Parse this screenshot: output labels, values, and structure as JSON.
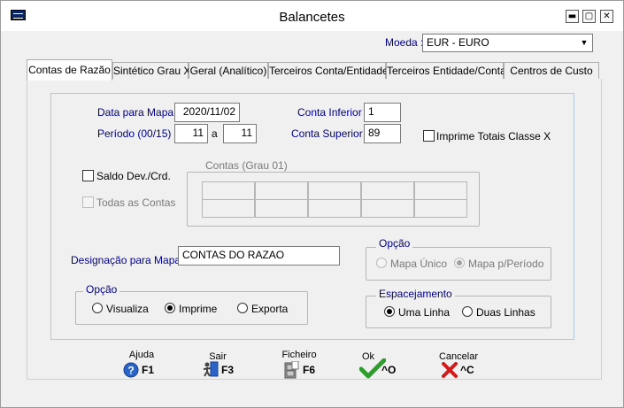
{
  "window": {
    "title": "Balancetes",
    "buttons": {
      "minimize": "▬",
      "maximize": "▢",
      "close": "✕"
    }
  },
  "currency": {
    "label": "Moeda :",
    "value": "EUR - EURO"
  },
  "tabs": [
    {
      "label": "Contas de Razão",
      "active": true
    },
    {
      "label": "Sintético Grau X",
      "active": false
    },
    {
      "label": "Geral (Analítico)",
      "active": false
    },
    {
      "label": "Terceiros Conta/Entidade",
      "active": false
    },
    {
      "label": "Terceiros Entidade/Conta",
      "active": false
    },
    {
      "label": "Centros de Custo",
      "active": false
    }
  ],
  "form": {
    "data_mapa_label": "Data para Mapa",
    "data_mapa_value": "2020/11/02",
    "periodo_label": "Período (00/15)",
    "periodo_from": "11",
    "periodo_sep": "a",
    "periodo_to": "11",
    "conta_inferior_label": "Conta Inferior",
    "conta_inferior_value": "1",
    "conta_superior_label": "Conta Superior",
    "conta_superior_value": "89",
    "imprime_totais_label": "Imprime Totais Classe X",
    "saldo_label": "Saldo Dev./Crd.",
    "todas_contas_label": "Todas as Contas",
    "contas_group_title": "Contas (Grau 01)",
    "designacao_label": "Designação para Mapa",
    "designacao_value": "CONTAS DO RAZAO"
  },
  "opcao_output": {
    "title": "Opção",
    "options": [
      "Visualiza",
      "Imprime",
      "Exporta"
    ],
    "selected": "Imprime"
  },
  "opcao_mapa": {
    "title": "Opção",
    "options": [
      "Mapa Único",
      "Mapa p/Período"
    ],
    "selected": "Mapa p/Período",
    "disabled": true
  },
  "espacamento": {
    "title": "Espacejamento",
    "options": [
      "Uma Linha",
      "Duas Linhas"
    ],
    "selected": "Uma Linha"
  },
  "toolbar": {
    "ajuda": {
      "caption": "Ajuda",
      "key": "F1"
    },
    "sair": {
      "caption": "Sair",
      "key": "F3"
    },
    "ficheiro": {
      "caption": "Ficheiro",
      "key": "F6"
    },
    "ok": {
      "caption": "Ok",
      "key": "^O"
    },
    "cancelar": {
      "caption": "Cancelar",
      "key": "^C"
    }
  },
  "colors": {
    "label_blue": "#00008b",
    "ok_green": "#2e9d2e",
    "cancel_red": "#d11a1a",
    "help_blue": "#2a64c8"
  }
}
